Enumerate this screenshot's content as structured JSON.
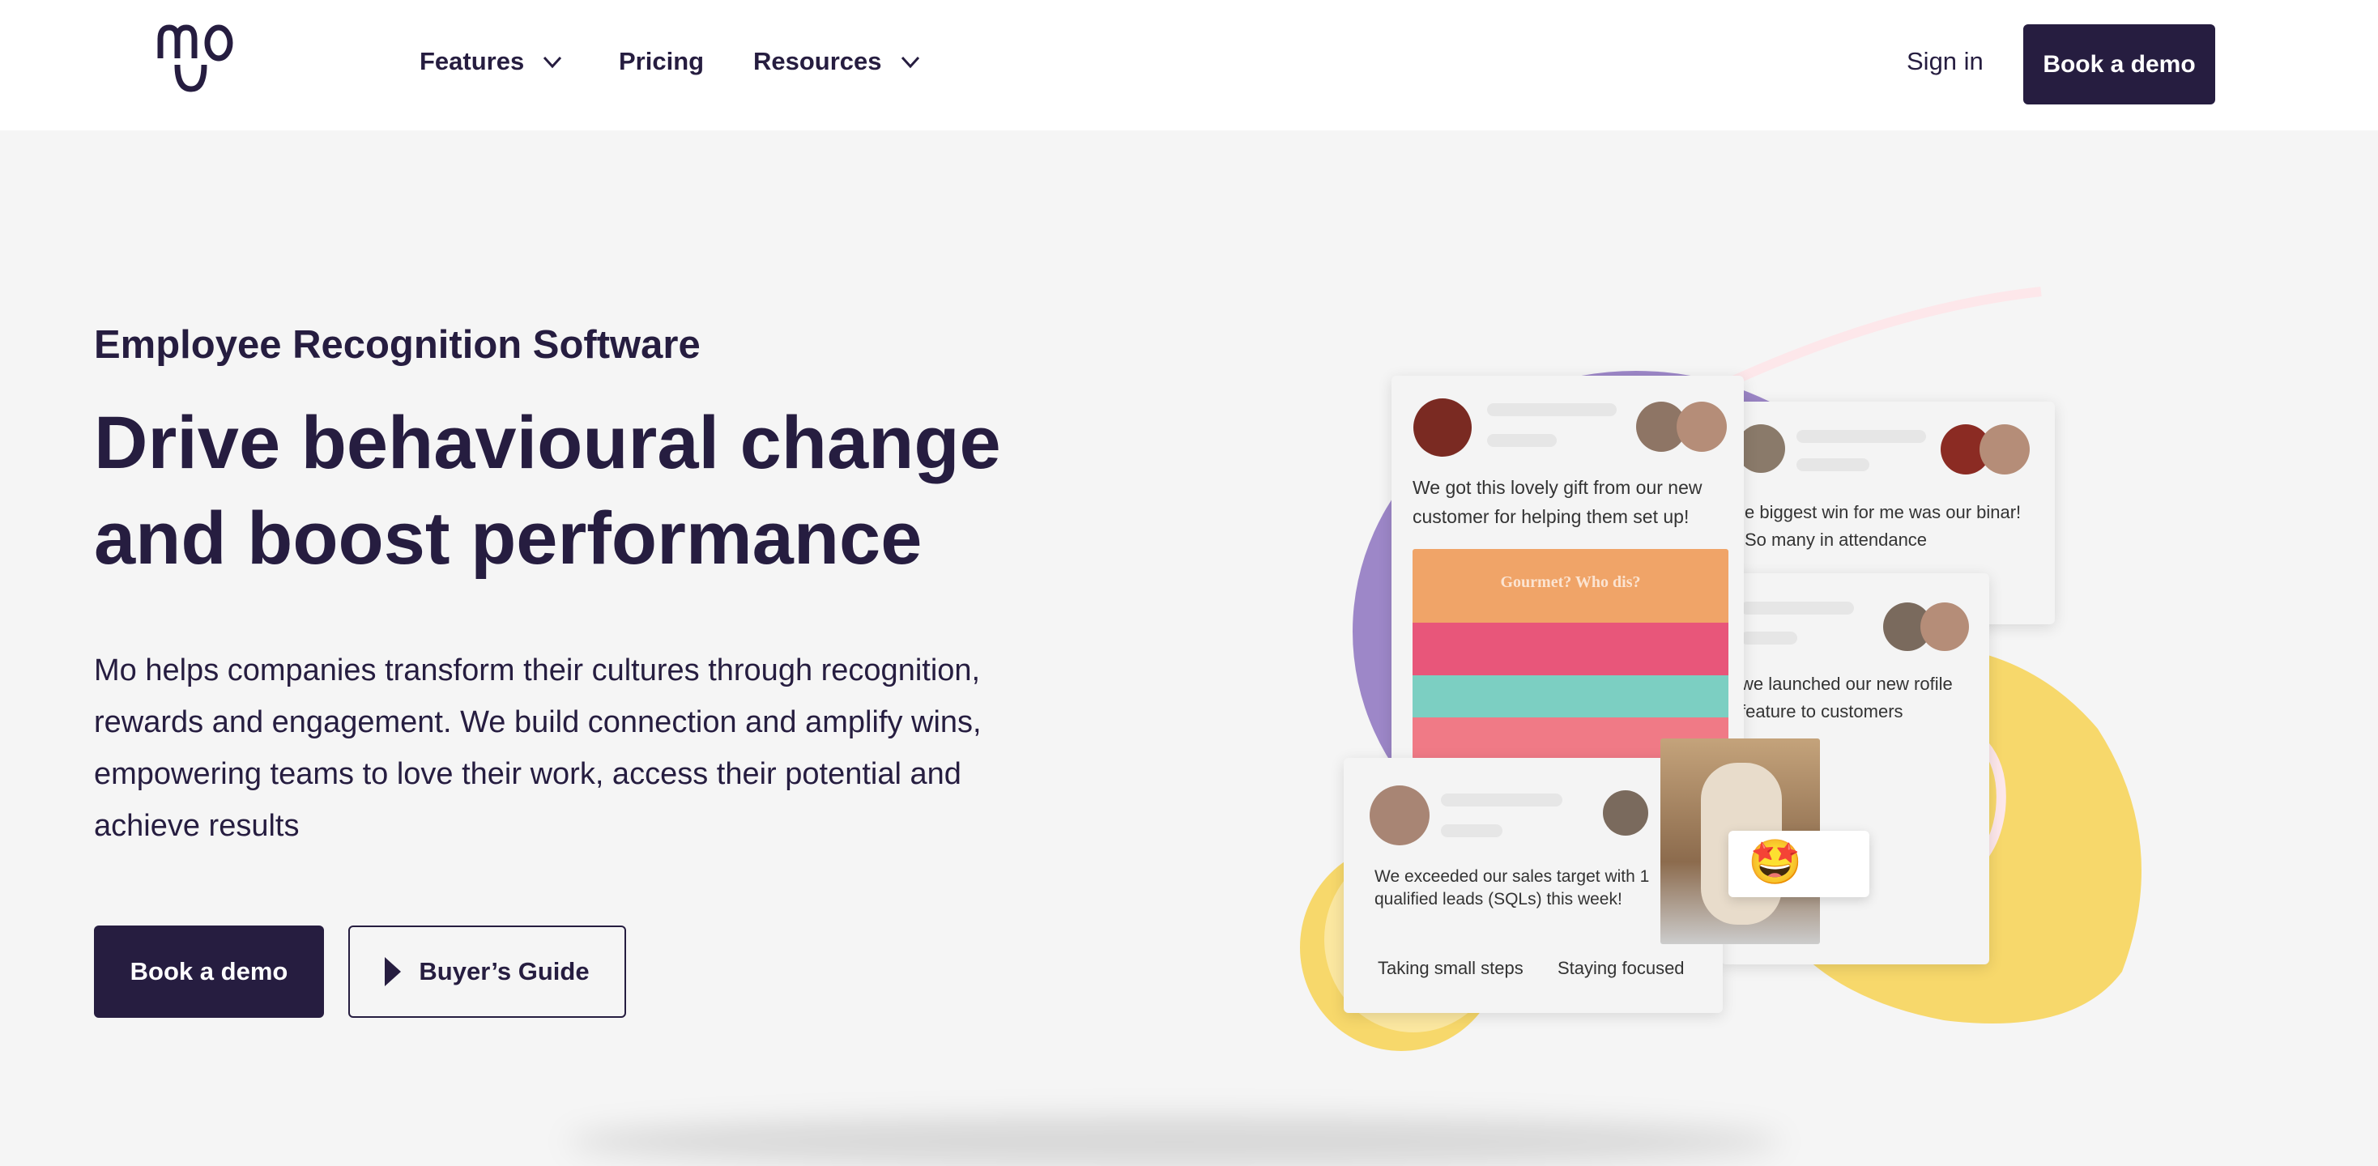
{
  "header": {
    "logo_text": "mo",
    "nav": [
      {
        "label": "Features",
        "has_dropdown": true
      },
      {
        "label": "Pricing",
        "has_dropdown": false
      },
      {
        "label": "Resources",
        "has_dropdown": true
      }
    ],
    "sign_in": "Sign in",
    "cta": "Book a demo"
  },
  "hero": {
    "kicker": "Employee Recognition Software",
    "title_line1": "Drive behavioural change",
    "title_line2": "and boost performance",
    "description": "Mo helps companies transform their cultures through recognition, rewards and engagement. We build connection and amplify wins, empowering teams to love their work, access their potential and achieve results",
    "primary_button": "Book a demo",
    "secondary_button": "Buyer’s Guide"
  },
  "illustration": {
    "cards": [
      {
        "text": "We got this lovely gift from our new customer for helping them set up!",
        "image_caption": "Gourmet? Who dis?"
      },
      {
        "text": "e biggest win for me was our binar! So many in attendance"
      },
      {
        "text": "we launched our new rofile feature to customers"
      },
      {
        "text": "We exceeded our sales target with 1 qualified leads (SQLs) this week!",
        "tags": [
          "Taking small steps",
          "Staying focused"
        ]
      }
    ],
    "emoji": "🤩"
  },
  "colors": {
    "brand": "#261d40",
    "purple": "#9d87c8",
    "yellow": "#f7d86b",
    "background": "#f5f5f5"
  }
}
